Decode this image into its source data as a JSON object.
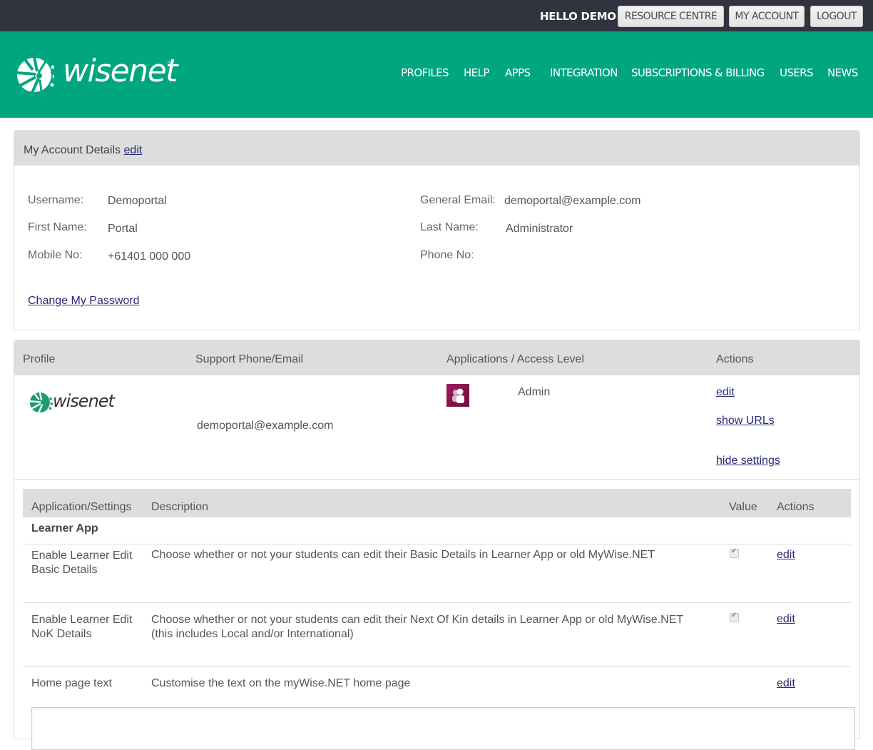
{
  "topbar": {
    "greeting": "HELLO DEMO",
    "buttons": [
      "RESOURCE CENTRE",
      "MY ACCOUNT",
      "LOGOUT"
    ]
  },
  "header": {
    "logo_text": "wisenet",
    "logo_tm": "™",
    "brand_color": "#00a680",
    "nav": [
      "PROFILES",
      "HELP",
      "APPS",
      "INTEGRATION",
      "SUBSCRIPTIONS & BILLING",
      "USERS",
      "NEWS"
    ]
  },
  "account": {
    "title": "My Account Details",
    "edit_label": "edit",
    "fields": {
      "username_label": "Username:",
      "username": "Demoportal",
      "first_name_label": "First Name:",
      "first_name": "Portal",
      "mobile_label": "Mobile No:",
      "mobile": "+61401 000 000",
      "email_label": "General Email:",
      "email": "demoportal@example.com",
      "last_name_label": "Last Name:",
      "last_name": "Administrator",
      "phone_label": "Phone No:",
      "phone": ""
    },
    "change_password": "Change My Password"
  },
  "profiles": {
    "headers": [
      "Profile",
      "Support Phone/Email",
      "Applications / Access Level",
      "Actions"
    ],
    "row": {
      "logo_text": "wisenet",
      "support": "demoportal@example.com",
      "app_icon": "users-app-icon",
      "access_level": "Admin",
      "actions": [
        "edit",
        "show URLs",
        "hide settings"
      ]
    }
  },
  "settings": {
    "headers": [
      "Application/Settings",
      "Description",
      "Value",
      "Actions"
    ],
    "group": "Learner App",
    "rows": [
      {
        "name": [
          "Enable Learner Edit",
          "Basic Details"
        ],
        "description": [
          "Choose whether or not your students can edit their Basic Details in Learner App or old MyWise.NET"
        ],
        "checked": true,
        "action": "edit"
      },
      {
        "name": [
          "Enable Learner Edit",
          "NoK Details"
        ],
        "description": [
          "Choose whether or not your students can edit their Next Of Kin details in Learner App or old MyWise.NET",
          "(this includes Local and/or International)"
        ],
        "checked": true,
        "action": "edit"
      },
      {
        "name": [
          "Home page text"
        ],
        "description": [
          "Customise the text on the myWise.NET home page"
        ],
        "checked": null,
        "action": "edit"
      }
    ],
    "home_text_value": ""
  }
}
